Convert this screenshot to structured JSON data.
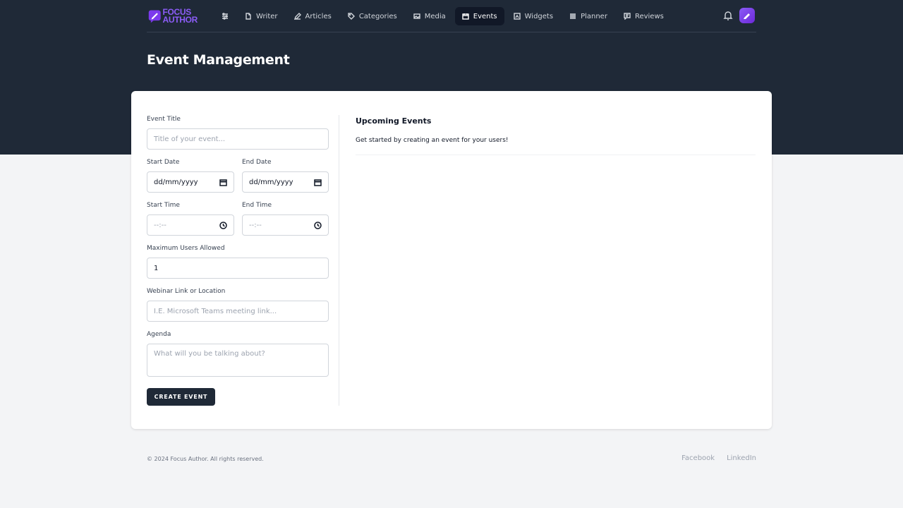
{
  "brand": {
    "line1": "FOCUS",
    "line2": "AUTHOR"
  },
  "nav": {
    "settings_icon": "sliders-icon",
    "items": [
      {
        "label": "Writer",
        "icon": "document-icon"
      },
      {
        "label": "Articles",
        "icon": "pencil-icon"
      },
      {
        "label": "Categories",
        "icon": "tag-icon"
      },
      {
        "label": "Media",
        "icon": "image-icon"
      },
      {
        "label": "Events",
        "icon": "calendar-icon",
        "active": true
      },
      {
        "label": "Widgets",
        "icon": "widget-icon"
      },
      {
        "label": "Planner",
        "icon": "list-icon"
      },
      {
        "label": "Reviews",
        "icon": "chat-icon"
      }
    ]
  },
  "page": {
    "title": "Event Management"
  },
  "form": {
    "event_title": {
      "label": "Event Title",
      "placeholder": "Title of your event..."
    },
    "start_date": {
      "label": "Start Date",
      "value": "dd/mm/yyyy"
    },
    "end_date": {
      "label": "End Date",
      "value": "dd/mm/yyyy"
    },
    "start_time": {
      "label": "Start Time",
      "value": "--:--"
    },
    "end_time": {
      "label": "End Time",
      "value": "--:--"
    },
    "max_users": {
      "label": "Maximum Users Allowed",
      "value": "1"
    },
    "location": {
      "label": "Webinar Link or Location",
      "placeholder": "I.E. Microsoft Teams meeting link..."
    },
    "agenda": {
      "label": "Agenda",
      "placeholder": "What will you be talking about?"
    },
    "submit_label": "CREATE EVENT"
  },
  "upcoming": {
    "title": "Upcoming Events",
    "empty_text": "Get started by creating an event for your users!"
  },
  "footer": {
    "copyright": "© 2024 Focus Author. All rights reserved.",
    "links": [
      "Facebook",
      "LinkedIn"
    ]
  },
  "colors": {
    "header_bg": "#1f2937",
    "accent": "#8b5cf6",
    "page_bg": "#f3f4f6"
  }
}
